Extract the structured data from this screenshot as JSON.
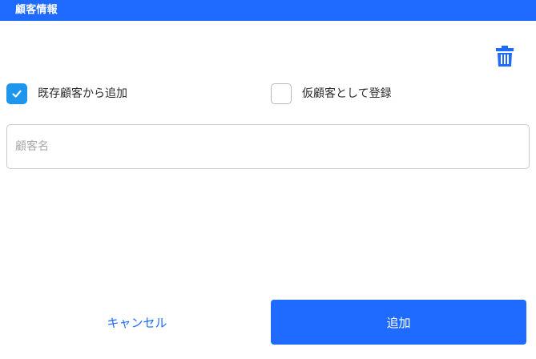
{
  "header": {
    "title": "顧客情報"
  },
  "toolbar": {
    "delete_icon": "trash-icon"
  },
  "options": [
    {
      "label": "既存顧客から追加",
      "checked": true
    },
    {
      "label": "仮顧客として登録",
      "checked": false
    }
  ],
  "customer_name": {
    "placeholder": "顧客名",
    "value": ""
  },
  "footer": {
    "cancel_label": "キャンセル",
    "add_label": "追加"
  },
  "colors": {
    "accent": "#1f6bff",
    "checkbox_checked": "#1e96ee"
  }
}
